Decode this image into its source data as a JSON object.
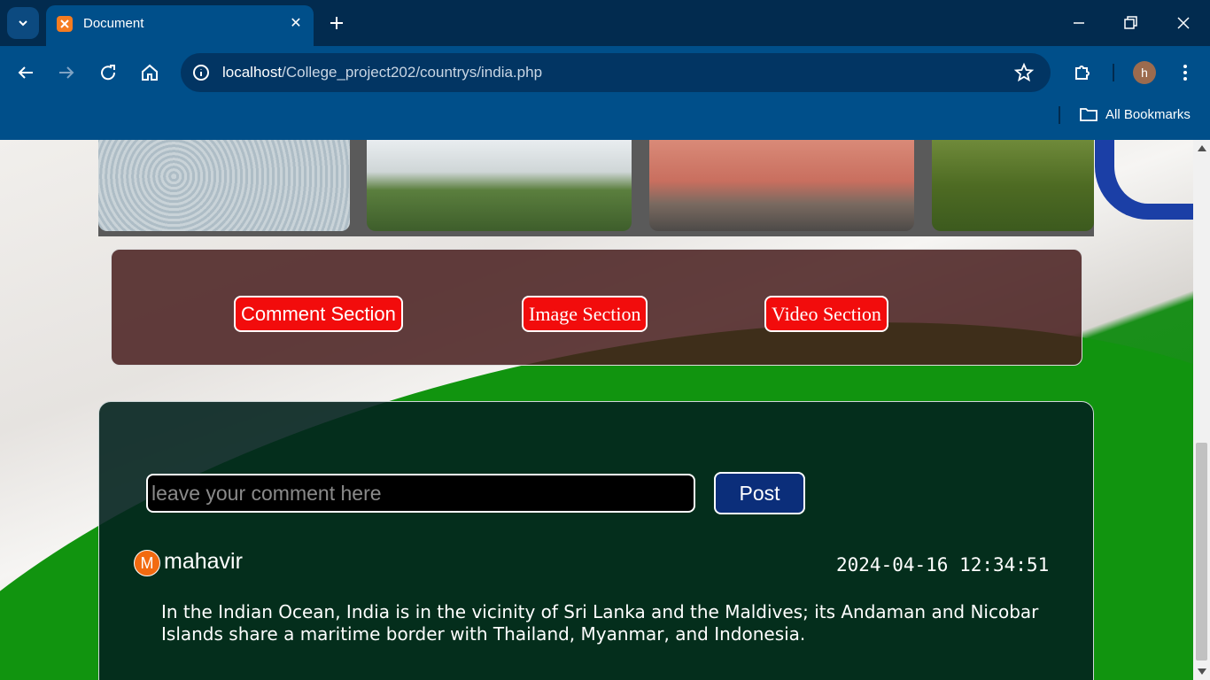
{
  "browser": {
    "tab_title": "Document",
    "url_host": "localhost",
    "url_path": "/College_project202/countrys/india.php",
    "profile_initial": "h",
    "bookmarks_label": "All Bookmarks",
    "icons": [
      "tab-list-icon",
      "xampp-favicon",
      "close-tab-icon",
      "new-tab-icon",
      "minimize-icon",
      "restore-icon",
      "close-window-icon",
      "back-icon",
      "forward-icon",
      "reload-icon",
      "home-icon",
      "site-info-icon",
      "bookmark-star-icon",
      "extensions-icon",
      "menu-icon",
      "folder-icon"
    ]
  },
  "sections": {
    "comment_label": "Comment Section",
    "image_label": "Image Section",
    "video_label": "Video Section"
  },
  "comment_form": {
    "placeholder": "leave your comment here",
    "post_label": "Post"
  },
  "comments": [
    {
      "avatar_initial": "M",
      "user": "mahavir",
      "timestamp": "2024-04-16 12:34:51",
      "text": "In the Indian Ocean, India is in the vicinity of Sri Lanka and the Maldives; its Andaman and Nicobar Islands share a maritime border with Thailand, Myanmar, and Indonesia."
    }
  ],
  "colors": {
    "chrome_dark": "#022b4f",
    "chrome": "#004f8a",
    "section_button": "#f20c0c",
    "post_button": "#0b2e7a",
    "avatar": "#f26a10"
  }
}
